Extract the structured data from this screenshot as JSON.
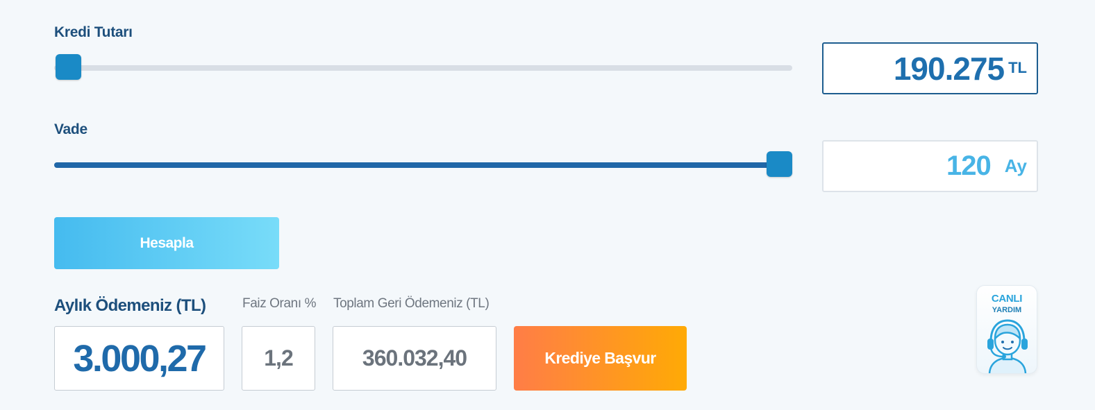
{
  "loan_amount": {
    "label": "Kredi Tutarı",
    "value": "190.275",
    "unit": "TL",
    "slider_fraction": 0.0
  },
  "term": {
    "label": "Vade",
    "value": "120",
    "unit": "Ay",
    "slider_fraction": 1.0
  },
  "calculate_button": "Hesapla",
  "results": {
    "monthly_payment_label": "Aylık Ödemeniz (TL)",
    "monthly_payment_value": "3.000,27",
    "interest_rate_label": "Faiz Oranı %",
    "interest_rate_value": "1,2",
    "total_repayment_label": "Toplam Geri Ödemeniz (TL)",
    "total_repayment_value": "360.032,40"
  },
  "apply_button": "Krediye Başvur",
  "live_help": {
    "line1": "CANLI",
    "line2": "YARDIM",
    "icon": "support-agent-icon"
  },
  "colors": {
    "brand_dark": "#1d4f7c",
    "slider_fill": "#2067a8",
    "slider_thumb": "#1a8ac6",
    "accent_light": "#48b4e6",
    "apply_gradient": [
      "#ff7d47",
      "#ffaa05"
    ],
    "calculate_gradient": [
      "#45bbef",
      "#78dcf9"
    ]
  }
}
